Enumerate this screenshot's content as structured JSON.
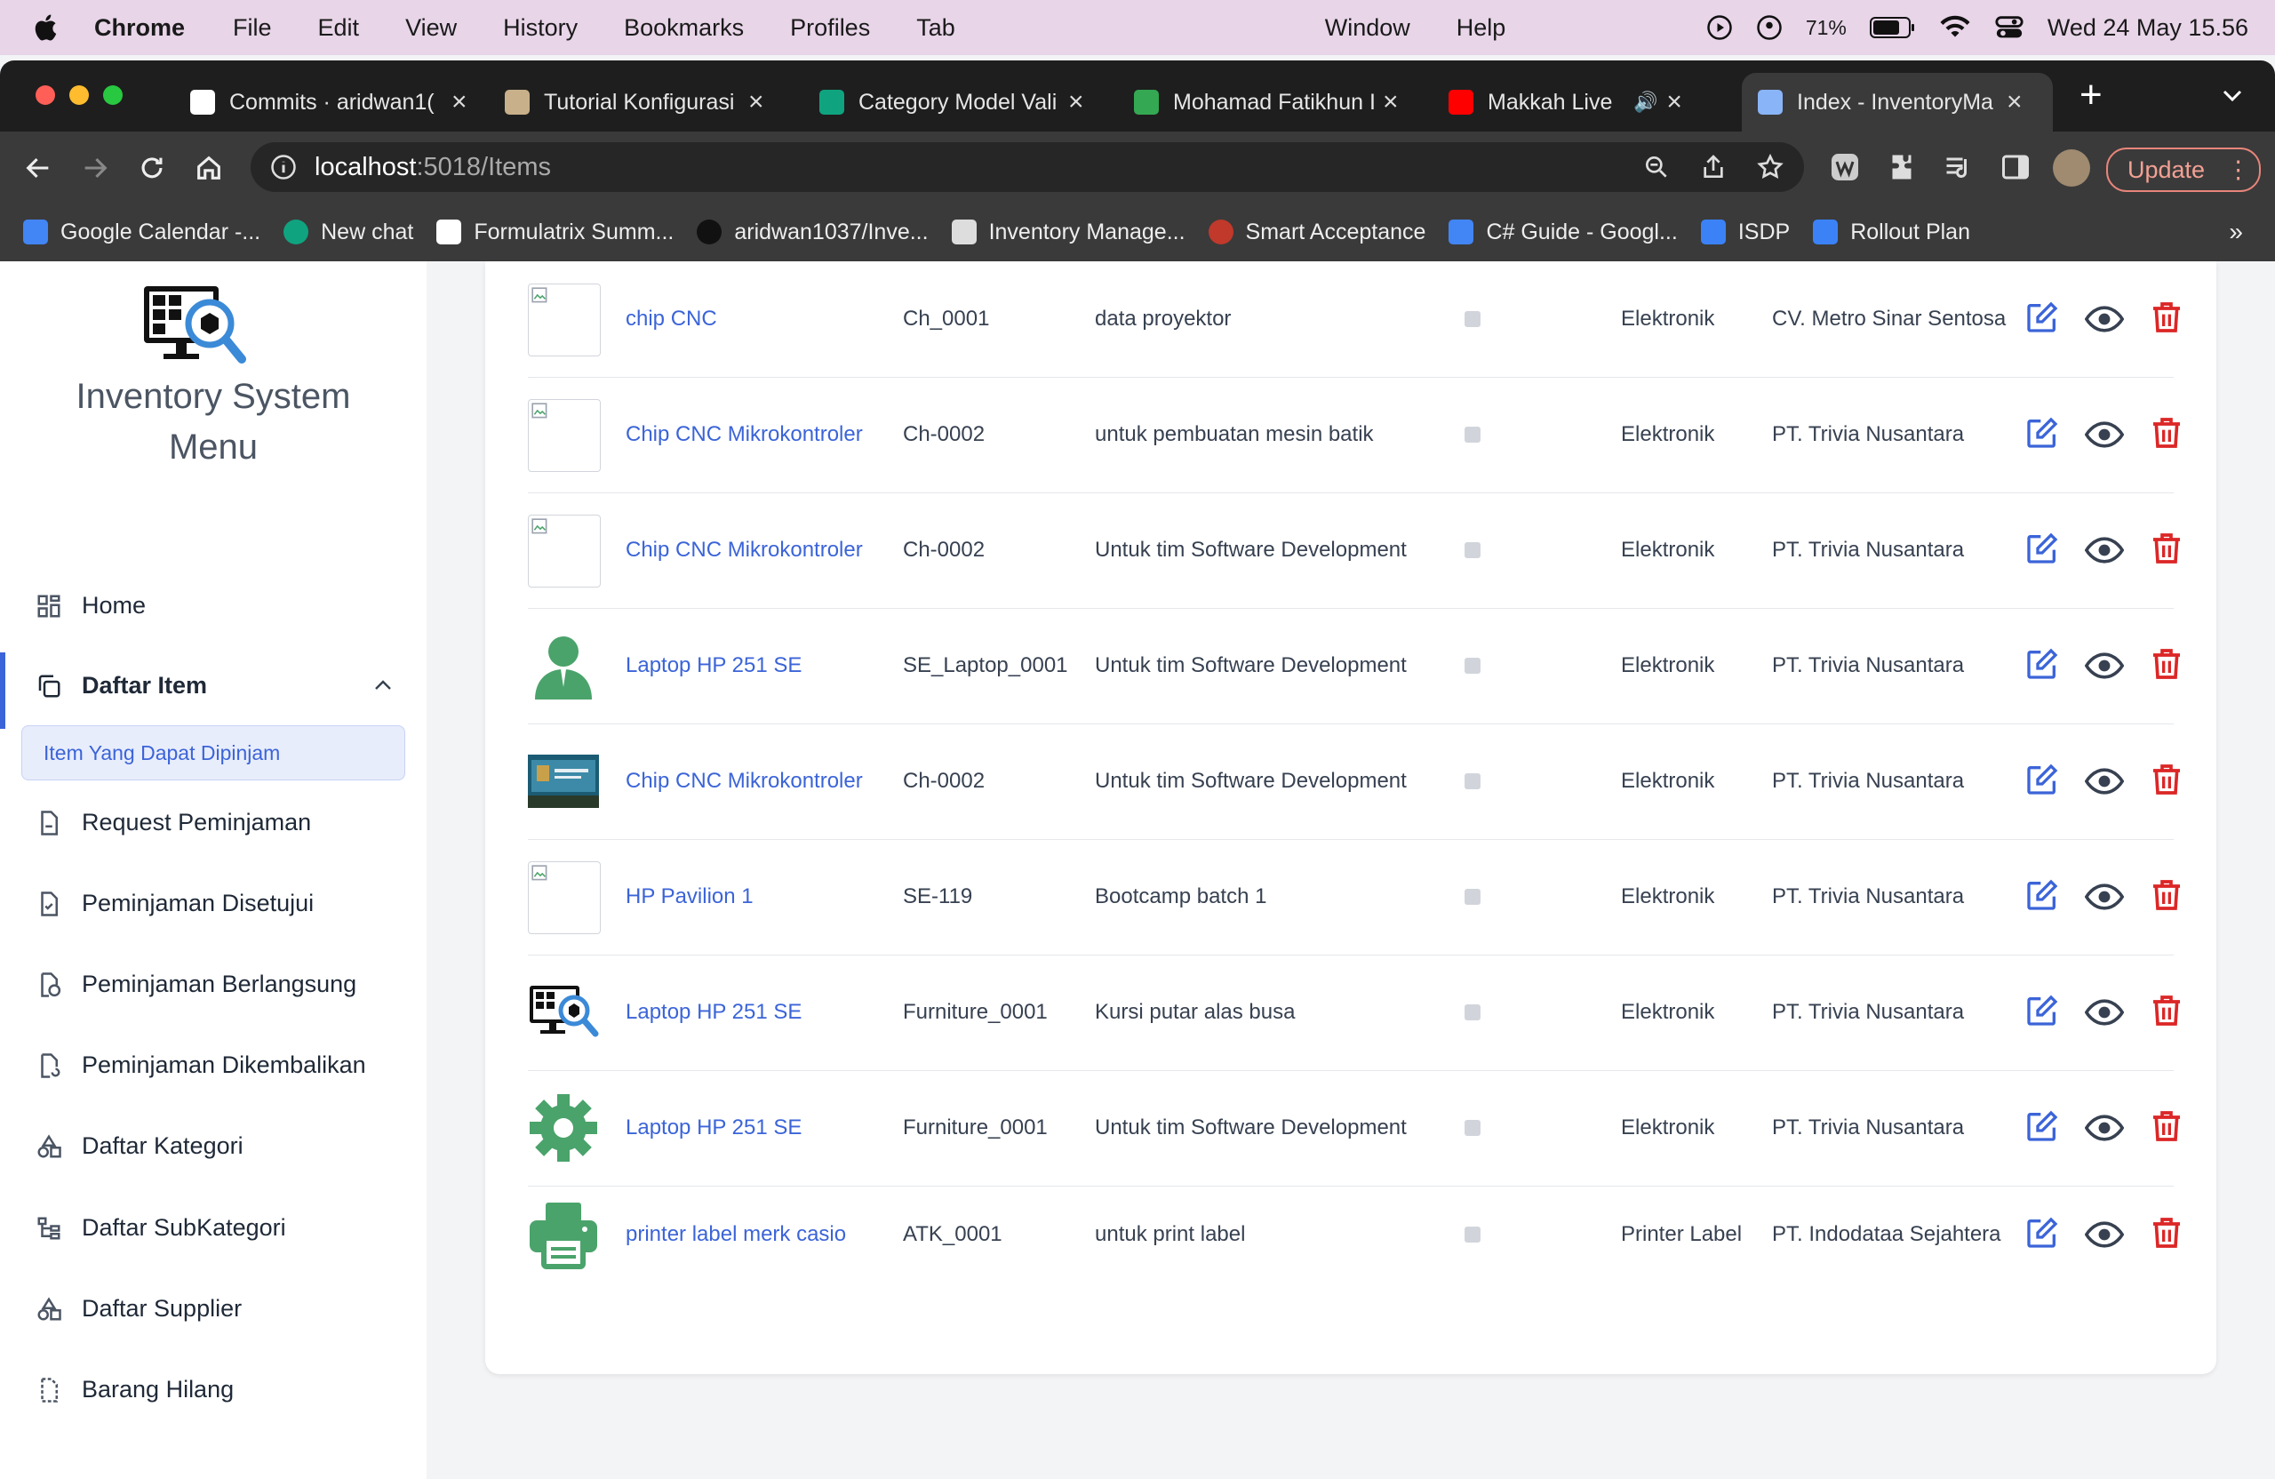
{
  "mac_menu": {
    "app": "Chrome",
    "items": [
      "File",
      "Edit",
      "View",
      "History",
      "Bookmarks",
      "Profiles",
      "Tab",
      "Window",
      "Help"
    ],
    "battery": "71%",
    "datetime": "Wed 24 May  15.56"
  },
  "tabs": [
    {
      "label": "Commits · aridwan1(",
      "color": "#ffffff"
    },
    {
      "label": "Tutorial Konfigurasi",
      "color": "#c8b08a"
    },
    {
      "label": "Category Model Vali",
      "color": "#10a37f"
    },
    {
      "label": "Mohamad Fatikhun I",
      "color": "#34a853"
    },
    {
      "label": "Makkah Live",
      "color": "#ff0000"
    },
    {
      "label": "Index - InventoryMa",
      "color": "#8ab4f8"
    }
  ],
  "address": {
    "host": "localhost",
    "path": ":5018/Items"
  },
  "update_label": "Update",
  "bookmarks": [
    {
      "label": "Google Calendar -...",
      "color": "#4285f4"
    },
    {
      "label": "New chat",
      "color": "#10a37f"
    },
    {
      "label": "Formulatrix Summ...",
      "color": "#ffffff"
    },
    {
      "label": "aridwan1037/Inve...",
      "color": "#111111"
    },
    {
      "label": "Inventory Manage...",
      "color": "#dddddd"
    },
    {
      "label": "Smart Acceptance",
      "color": "#c0392b"
    },
    {
      "label": "C# Guide - Googl...",
      "color": "#4285f4"
    },
    {
      "label": "ISDP",
      "color": "#3b82f6"
    },
    {
      "label": "Rollout Plan",
      "color": "#3b82f6"
    }
  ],
  "sidebar": {
    "title_line1": "Inventory System",
    "title_line2": "Menu",
    "items": [
      {
        "label": "Home"
      },
      {
        "label": "Daftar Item"
      },
      {
        "label": "Item Yang Dapat Dipinjam"
      },
      {
        "label": "Request Peminjaman"
      },
      {
        "label": "Peminjaman Disetujui"
      },
      {
        "label": "Peminjaman Berlangsung"
      },
      {
        "label": "Peminjaman Dikembalikan"
      },
      {
        "label": "Daftar Kategori"
      },
      {
        "label": "Daftar SubKategori"
      },
      {
        "label": "Daftar Supplier"
      },
      {
        "label": "Barang Hilang"
      }
    ]
  },
  "rows": [
    {
      "name": "chip CNC",
      "code": "Ch_0001",
      "desc": "data proyektor",
      "category": "Elektronik",
      "supplier": "CV. Metro Sinar Sentosa",
      "image": "broken"
    },
    {
      "name": "Chip CNC Mikrokontroler",
      "code": "Ch-0002",
      "desc": "untuk pembuatan mesin batik",
      "category": "Elektronik",
      "supplier": "PT. Trivia Nusantara",
      "image": "broken"
    },
    {
      "name": "Chip CNC Mikrokontroler",
      "code": "Ch-0002",
      "desc": "Untuk tim Software Development",
      "category": "Elektronik",
      "supplier": "PT. Trivia Nusantara",
      "image": "broken"
    },
    {
      "name": "Laptop HP 251 SE",
      "code": "SE_Laptop_0001",
      "desc": "Untuk tim Software Development",
      "category": "Elektronik",
      "supplier": "PT. Trivia Nusantara",
      "image": "person"
    },
    {
      "name": "Chip CNC Mikrokontroler",
      "code": "Ch-0002",
      "desc": "Untuk tim Software Development",
      "category": "Elektronik",
      "supplier": "PT. Trivia Nusantara",
      "image": "photo"
    },
    {
      "name": "HP Pavilion 1",
      "code": "SE-119",
      "desc": "Bootcamp batch 1",
      "category": "Elektronik",
      "supplier": "PT. Trivia Nusantara",
      "image": "broken"
    },
    {
      "name": "Laptop HP 251 SE",
      "code": "Furniture_0001",
      "desc": "Kursi putar alas busa",
      "category": "Elektronik",
      "supplier": "PT. Trivia Nusantara",
      "image": "logo"
    },
    {
      "name": "Laptop HP 251 SE",
      "code": "Furniture_0001",
      "desc": "Untuk tim Software Development",
      "category": "Elektronik",
      "supplier": "PT. Trivia Nusantara",
      "image": "gear"
    },
    {
      "name": "printer label merk casio",
      "code": "ATK_0001",
      "desc": "untuk print label",
      "category": "Printer Label",
      "supplier": "PT. Indodataa Sejahtera",
      "image": "printer"
    }
  ],
  "colors": {
    "link": "#3b64d8",
    "edit": "#3b64d8",
    "delete": "#dc2626",
    "accent": "#3b64d8",
    "thumb_green": "#4aa36b"
  }
}
